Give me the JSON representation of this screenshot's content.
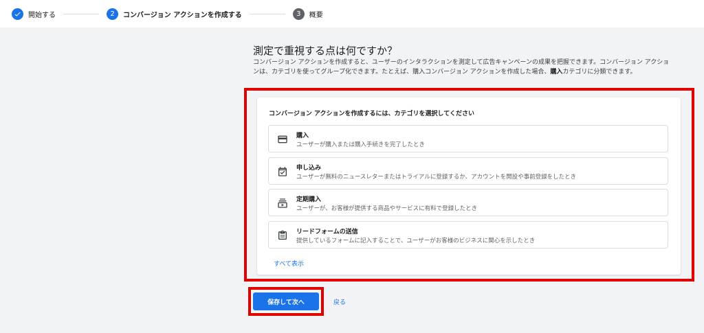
{
  "stepper": {
    "steps": [
      {
        "label": "開始する",
        "number": "",
        "state": "done"
      },
      {
        "label": "コンバージョン アクションを作成する",
        "number": "2",
        "state": "active"
      },
      {
        "label": "概要",
        "number": "3",
        "state": "todo"
      }
    ]
  },
  "main": {
    "heading": "測定で重視する点は何ですか？",
    "description_part1": "コンバージョン アクションを作成すると、ユーザーのインタラクションを測定して広告キャンペーンの成果を把握できます。コンバージョン アクションは、カテゴリを使ってグループ化できます。たとえば、購入コンバージョン アクションを作成した場合、",
    "description_bold": "購入",
    "description_part2": "カテゴリに分類できます。"
  },
  "card": {
    "title": "コンバージョン アクションを作成するには、カテゴリを選択してください",
    "options": [
      {
        "title": "購入",
        "description": "ユーザーが購入または購入手続きを完了したとき",
        "icon": "credit-card-icon"
      },
      {
        "title": "申し込み",
        "description": "ユーザーが無料のニュースレターまたはトライアルに登録するか、アカウントを開設や事前登録をしたとき",
        "icon": "event-check-icon"
      },
      {
        "title": "定期購入",
        "description": "ユーザーが、お客様が提供する商品やサービスに有料で登録したとき",
        "icon": "subscriptions-icon"
      },
      {
        "title": "リードフォームの送信",
        "description": "提供しているフォームに記入することで、ユーザーがお客様のビジネスに関心を示したとき",
        "icon": "clipboard-icon"
      }
    ],
    "show_all": "すべて表示"
  },
  "actions": {
    "save_label": "保存して次へ",
    "back_label": "戻る"
  },
  "colors": {
    "accent": "#1a73e8",
    "highlight": "#e00000"
  }
}
